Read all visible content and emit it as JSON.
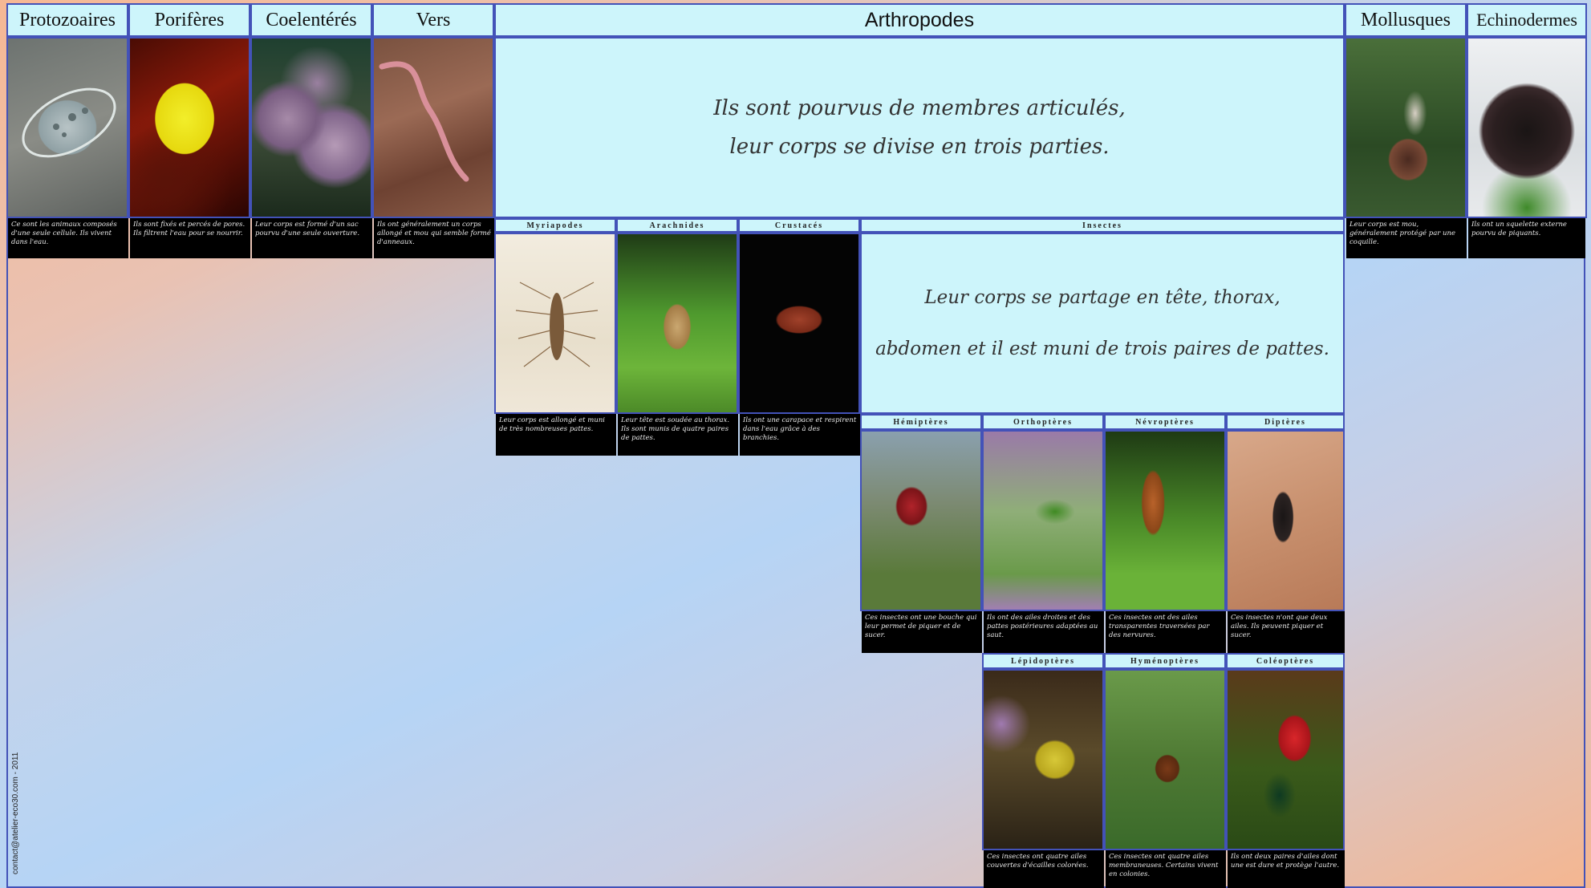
{
  "phyla": {
    "protozoaires": "Protozoaires",
    "poriferes": "Porifères",
    "coelenteres": "Coelentérés",
    "vers": "Vers",
    "arthropodes": "Arthropodes",
    "mollusques": "Mollusques",
    "echinodermes": "Echinodermes"
  },
  "arthropodes_text": [
    "Ils sont pourvus de membres articulés,",
    "leur corps se divise en trois parties."
  ],
  "arthropod_groups": {
    "myriapodes": "Myriapodes",
    "arachnides": "Arachnides",
    "crustaces": "Crustacés",
    "insectes": "Insectes"
  },
  "insectes_text": [
    "Leur corps se partage en tête, thorax,",
    "abdomen et il est muni de trois paires de pattes."
  ],
  "insect_orders": {
    "hemipteres": "Hémiptères",
    "orthopteres": "Orthoptères",
    "nevropteres": "Névroptères",
    "dipteres": "Diptères",
    "lepidopteres": "Lépidoptères",
    "hymenopteres": "Hyménoptères",
    "coleopteres": "Coléoptères"
  },
  "captions": {
    "protozoaires": "Ce sont les animaux composés d'une seule cellule. Ils vivent dans l'eau.",
    "poriferes": "Ils sont fixés et percés de pores. Ils filtrent l'eau pour se nourrir.",
    "coelenteres": "Leur corps est formé d'un sac pourvu d'une seule ouverture.",
    "vers": "Ils ont généralement un corps allongé et mou qui semble formé d'anneaux.",
    "mollusques": "Leur corps est mou, généralement protégé par une coquille.",
    "echinodermes": "Ils ont un squelette externe pourvu de piquants.",
    "myriapodes": "Leur corps est allongé et muni de très nombreuses pattes.",
    "arachnides": "Leur tête est soudée au thorax. Ils sont munis de quatre paires de pattes.",
    "crustaces": "Ils ont une carapace et respirent dans l'eau grâce à des branchies.",
    "hemipteres": "Ces insectes ont une bouche qui leur permet de piquer et de sucer.",
    "orthopteres": "Ils ont des ailes droites et des pattes postérieures adaptées au saut.",
    "nevropteres": "Ces insectes ont des ailes transparentes traversées par des nervures.",
    "dipteres": "Ces insectes n'ont que deux ailes. Ils peuvent piquer et sucer.",
    "lepidopteres": "Ces insectes ont quatre ailes couvertes d'écailles colorées.",
    "hymenopteres": "Ces insectes ont quatre ailes membraneuses. Certains vivent en colonies.",
    "coleopteres": "Ils ont deux paires d'ailes dont une est dure et protège l'autre."
  },
  "credit": "contact@atelier-eco30.com - 2011",
  "colors": {
    "border": "#4352b8",
    "panel": "#cdf5fb",
    "caption_bg": "#000000"
  }
}
